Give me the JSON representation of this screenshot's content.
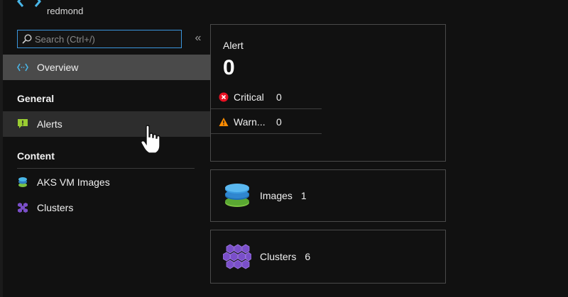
{
  "resource": {
    "name": "redmond"
  },
  "search": {
    "placeholder": "Search (Ctrl+/)",
    "value": ""
  },
  "collapse_label": "«",
  "nav": {
    "overview": {
      "label": "Overview",
      "icon": "overview-icon"
    },
    "general": {
      "heading": "General",
      "items": [
        {
          "label": "Alerts",
          "icon": "alerts-icon"
        }
      ]
    },
    "content": {
      "heading": "Content",
      "items": [
        {
          "label": "AKS VM Images",
          "icon": "vm-images-icon"
        },
        {
          "label": "Clusters",
          "icon": "clusters-icon"
        }
      ]
    }
  },
  "alert_card": {
    "title": "Alert",
    "count": "0",
    "rows": [
      {
        "label": "Critical",
        "value": "0",
        "icon": "critical-icon",
        "color": "#e81123"
      },
      {
        "label": "Warn...",
        "value": "0",
        "icon": "warning-icon",
        "color": "#ff8c00"
      }
    ]
  },
  "tiles": {
    "images": {
      "label": "Images",
      "value": "1",
      "icon": "images-stack-icon"
    },
    "clusters": {
      "label": "Clusters",
      "value": "6",
      "icon": "clusters-hex-icon"
    }
  },
  "colors": {
    "background": "#111111",
    "selected": "#4a4a4a",
    "hover": "#2d2d2d",
    "accent": "#3a96dd",
    "card_border": "#4a4a4a"
  }
}
